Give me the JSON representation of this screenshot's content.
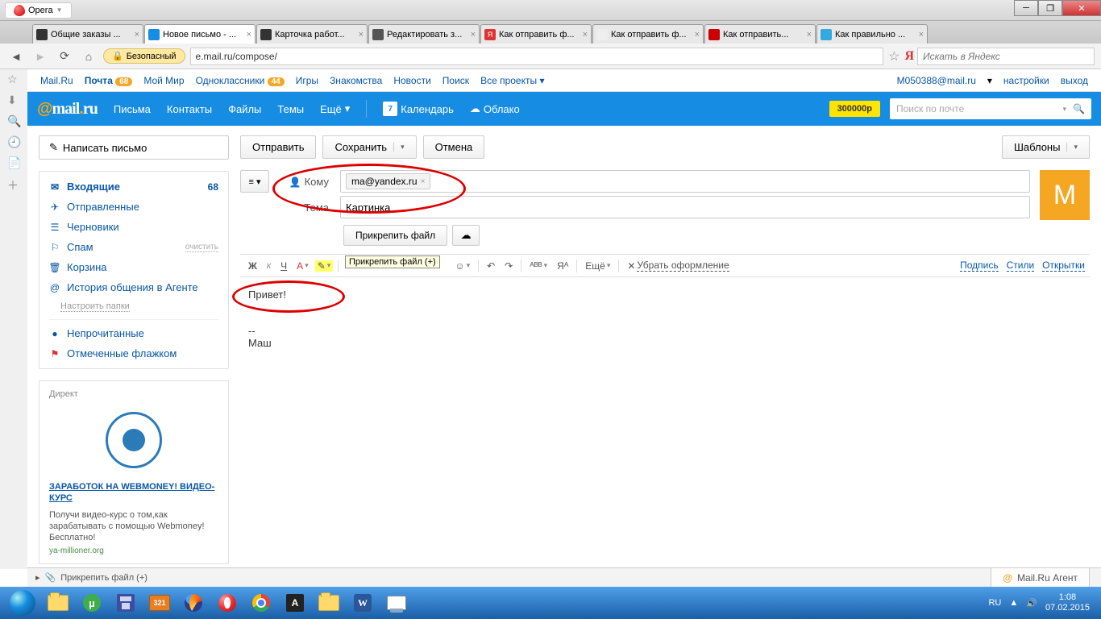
{
  "window": {
    "opera_label": "Opera",
    "min": "_",
    "max": "▢",
    "close": "✕"
  },
  "tabs": [
    {
      "label": "Общие заказы ..."
    },
    {
      "label": "Новое письмо - ...",
      "active": true
    },
    {
      "label": "Карточка работ..."
    },
    {
      "label": "Редактировать з..."
    },
    {
      "label": "Как отправить ф..."
    },
    {
      "label": "Как отправить ф..."
    },
    {
      "label": "Как отправить..."
    },
    {
      "label": "Как правильно ..."
    }
  ],
  "addr": {
    "safe": "Безопасный",
    "url": "e.mail.ru/compose/",
    "yandex_placeholder": "Искать в Яндекс"
  },
  "portal": {
    "links": [
      "Mail.Ru",
      "Почта",
      "Мой Мир",
      "Одноклассники",
      "Игры",
      "Знакомства",
      "Новости",
      "Поиск",
      "Все проекты"
    ],
    "badge_mail": "68",
    "badge_ok": "44",
    "email": "M050388@mail.ru",
    "settings": "настройки",
    "exit": "выход"
  },
  "header": {
    "items": [
      "Письма",
      "Контакты",
      "Файлы",
      "Темы",
      "Ещё"
    ],
    "calendar": "Календарь",
    "cal_day": "7",
    "cloud": "Облако",
    "promo": "300000р",
    "search_ph": "Поиск по почте"
  },
  "compose_btn": "Написать письмо",
  "folders": {
    "inbox": "Входящие",
    "inbox_cnt": "68",
    "sent": "Отправленные",
    "drafts": "Черновики",
    "spam": "Спам",
    "spam_clear": "очистить",
    "trash": "Корзина",
    "agent": "История общения в Агенте",
    "configure": "Настроить папки",
    "unread": "Непрочитанные",
    "flagged": "Отмеченные флажком"
  },
  "ad": {
    "label": "Директ",
    "headline": "ЗАРАБОТОК НА WEBMONEY! ВИДЕО-КУРС",
    "text": "Получи видео-курс о том,как зарабатывать с помощью Webmoney! Бесплатно!",
    "src": "ya-millioner.org"
  },
  "toolbar": {
    "send": "Отправить",
    "save": "Сохранить",
    "cancel": "Отмена",
    "templates": "Шаблоны"
  },
  "form": {
    "to_label": "Кому",
    "recipient": "ma@yandex.ru",
    "subject_label": "Тема",
    "subject_value": "Картинка",
    "attach": "Прикрепить файл",
    "avatar": "M"
  },
  "editor": {
    "tooltip": "Прикрепить файл (+)",
    "more": "Ещё",
    "clear_format": "Убрать оформление",
    "signature": "Подпись",
    "styles": "Стили",
    "cards": "Открытки"
  },
  "body": {
    "greeting": "Привет!",
    "sig_dash": "--",
    "sig_name": "Маш"
  },
  "bottom": {
    "attach": "Прикрепить файл (+)",
    "agent": "Mail.Ru Агент"
  },
  "tray": {
    "lang": "RU",
    "time": "1:08",
    "date": "07.02.2015"
  }
}
